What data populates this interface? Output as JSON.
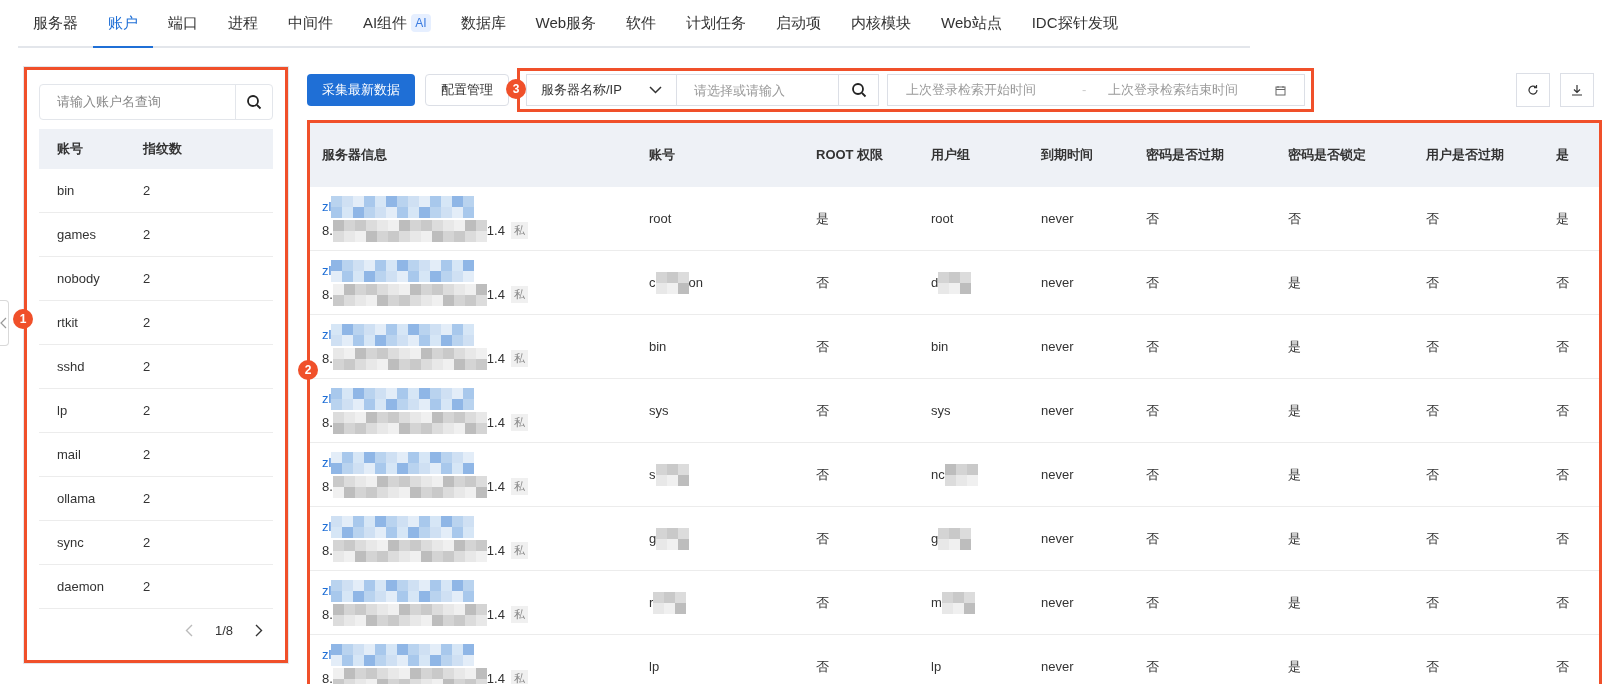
{
  "tabs": [
    {
      "label": "服务器",
      "selected": false
    },
    {
      "label": "账户",
      "selected": true
    },
    {
      "label": "端口",
      "selected": false
    },
    {
      "label": "进程",
      "selected": false
    },
    {
      "label": "中间件",
      "selected": false
    },
    {
      "label": "AI组件",
      "badge": "AI",
      "selected": false
    },
    {
      "label": "数据库",
      "selected": false
    },
    {
      "label": "Web服务",
      "selected": false
    },
    {
      "label": "软件",
      "selected": false
    },
    {
      "label": "计划任务",
      "selected": false
    },
    {
      "label": "启动项",
      "selected": false
    },
    {
      "label": "内核模块",
      "selected": false
    },
    {
      "label": "Web站点",
      "selected": false
    },
    {
      "label": "IDC探针发现",
      "selected": false
    }
  ],
  "account_panel": {
    "annotation": "1",
    "search": {
      "placeholder": "请输入账户名查询"
    },
    "columns": [
      "账号",
      "指纹数"
    ],
    "rows": [
      {
        "account": "bin",
        "count": "2"
      },
      {
        "account": "games",
        "count": "2"
      },
      {
        "account": "nobody",
        "count": "2"
      },
      {
        "account": "rtkit",
        "count": "2"
      },
      {
        "account": "sshd",
        "count": "2"
      },
      {
        "account": "lp",
        "count": "2"
      },
      {
        "account": "mail",
        "count": "2"
      },
      {
        "account": "ollama",
        "count": "2"
      },
      {
        "account": "sync",
        "count": "2"
      },
      {
        "account": "daemon",
        "count": "2"
      }
    ],
    "pagination": {
      "page": "1/8"
    }
  },
  "toolbar": {
    "buttons": [
      "采集最新数据",
      "配置管理"
    ],
    "filter": {
      "annotation": "3",
      "select": "服务器名称/IP",
      "input_placeholder": "请选择或请输入",
      "start_placeholder": "上次登录检索开始时间",
      "separator": "-",
      "end_placeholder": "上次登录检索结束时间"
    }
  },
  "table": {
    "annotation": "2",
    "columns": [
      "服务器信息",
      "账号",
      "ROOT 权限",
      "用户组",
      "到期时间",
      "密码是否过期",
      "密码是否锁定",
      "用户是否过期",
      "是"
    ],
    "rows": [
      {
        "server_name": "zl",
        "ip_start": "8.",
        "ip_end": "1.4",
        "tag": "私",
        "account": {
          "text": "root",
          "redacted": false
        },
        "root": "是",
        "group": {
          "text": "root",
          "redacted": false
        },
        "expiry": "never",
        "pwd_expired": "否",
        "pwd_locked": "否",
        "user_expired": "否",
        "column_9": "是"
      },
      {
        "server_name": "zl",
        "ip_start": "8.",
        "ip_end": "1.4",
        "tag": "私",
        "account": {
          "text": "c",
          "tail": "on",
          "redacted": true
        },
        "root": "否",
        "group": {
          "text": "d",
          "redacted": true
        },
        "expiry": "never",
        "pwd_expired": "否",
        "pwd_locked": "是",
        "user_expired": "否",
        "column_9": "否"
      },
      {
        "server_name": "zl",
        "ip_start": "8.",
        "ip_end": "1.4",
        "tag": "私",
        "account": {
          "text": "bin",
          "redacted": false
        },
        "root": "否",
        "group": {
          "text": "bin",
          "redacted": false
        },
        "expiry": "never",
        "pwd_expired": "否",
        "pwd_locked": "是",
        "user_expired": "否",
        "column_9": "否"
      },
      {
        "server_name": "zl",
        "ip_start": "8.",
        "ip_end": "1.4",
        "tag": "私",
        "account": {
          "text": "sys",
          "redacted": false
        },
        "root": "否",
        "group": {
          "text": "sys",
          "redacted": false
        },
        "expiry": "never",
        "pwd_expired": "否",
        "pwd_locked": "是",
        "user_expired": "否",
        "column_9": "否"
      },
      {
        "server_name": "zl",
        "ip_start": "8.",
        "ip_end": "1.4",
        "tag": "私",
        "account": {
          "text": "s",
          "redacted": true
        },
        "root": "否",
        "group": {
          "text": "nc",
          "redacted": true
        },
        "expiry": "never",
        "pwd_expired": "否",
        "pwd_locked": "是",
        "user_expired": "否",
        "column_9": "否"
      },
      {
        "server_name": "zl",
        "ip_start": "8.",
        "ip_end": "1.4",
        "tag": "私",
        "account": {
          "text": "g",
          "redacted": true
        },
        "root": "否",
        "group": {
          "text": "g",
          "redacted": true
        },
        "expiry": "never",
        "pwd_expired": "否",
        "pwd_locked": "是",
        "user_expired": "否",
        "column_9": "否"
      },
      {
        "server_name": "zl",
        "ip_start": "8.",
        "ip_end": "1.4",
        "tag": "私",
        "account": {
          "text": "r",
          "redacted": true
        },
        "root": "否",
        "group": {
          "text": "m",
          "redacted": true
        },
        "expiry": "never",
        "pwd_expired": "否",
        "pwd_locked": "是",
        "user_expired": "否",
        "column_9": "否"
      },
      {
        "server_name": "zl",
        "ip_start": "8.",
        "ip_end": "1.4",
        "tag": "私",
        "account": {
          "text": "lp",
          "redacted": false
        },
        "root": "否",
        "group": {
          "text": "lp",
          "redacted": false
        },
        "expiry": "never",
        "pwd_expired": "否",
        "pwd_locked": "是",
        "user_expired": "否",
        "column_9": "否"
      }
    ]
  }
}
